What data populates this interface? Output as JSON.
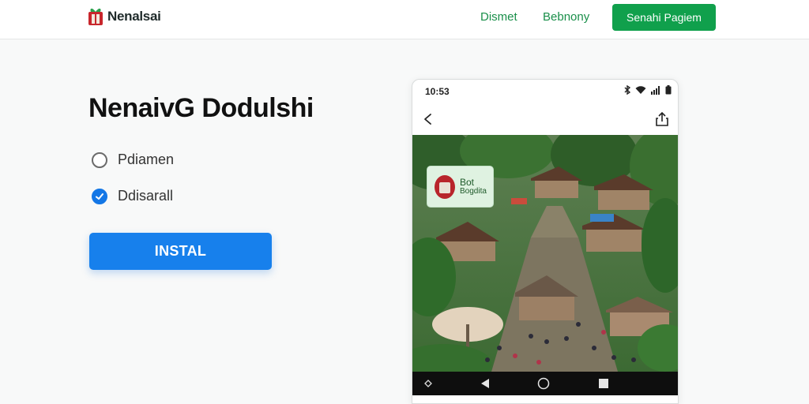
{
  "header": {
    "brand": "Nenalsai",
    "nav": [
      "Dismet",
      "Bebnony"
    ],
    "cta_label": "Senahi Pagiem"
  },
  "main": {
    "title": "NenaivG Dodulshi",
    "options": [
      {
        "label": "Pdiamen",
        "checked": false
      },
      {
        "label": "Ddisarall",
        "checked": true
      }
    ],
    "install_label": "INSTAL"
  },
  "phone": {
    "status_time": "10:53",
    "badge": {
      "line1": "Bot",
      "line2": "Bogdita"
    },
    "icons": [
      "bluetooth-icon",
      "wifi-icon",
      "signal-icon",
      "battery-icon",
      "back-arrow-icon",
      "share-icon"
    ]
  },
  "colors": {
    "brand_green": "#10a04c",
    "accent_blue": "#1780ec"
  }
}
